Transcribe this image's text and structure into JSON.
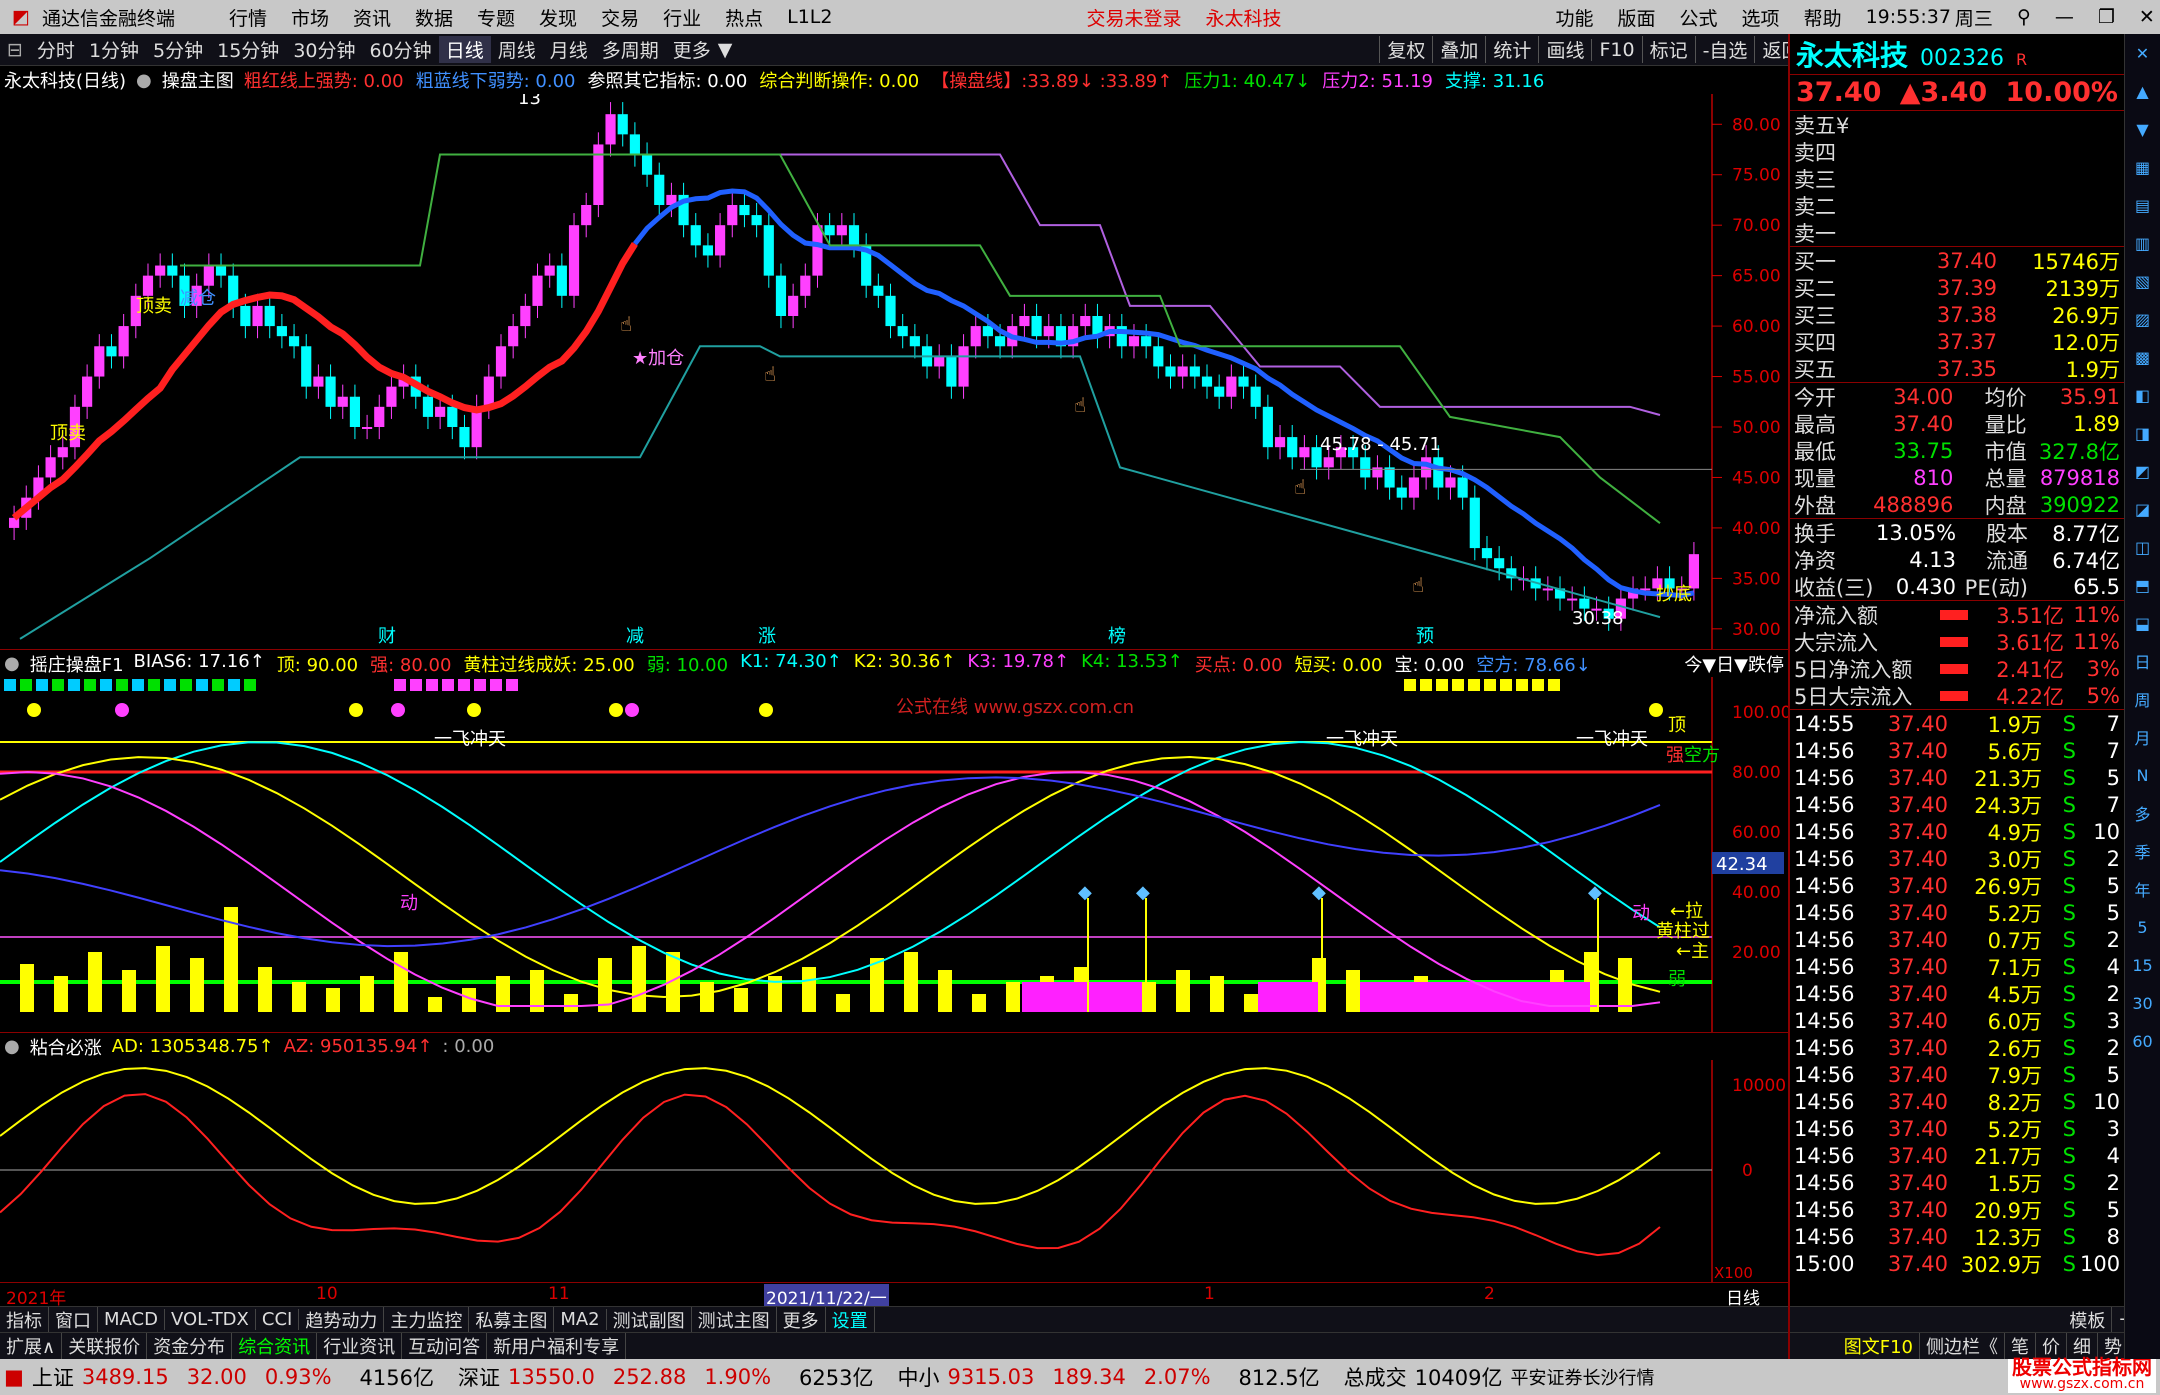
{
  "window": {
    "app": "通达信金融终端",
    "menu": [
      "行情",
      "市场",
      "资讯",
      "数据",
      "专题",
      "发现",
      "交易",
      "行业",
      "热点",
      "L1L2"
    ],
    "status": "交易未登录",
    "stock_center": "永太科技",
    "right_menu": [
      "功能",
      "版面",
      "公式",
      "选项",
      "帮助"
    ],
    "time": "19:55:37",
    "weekday": "周三"
  },
  "toolbar": {
    "periods": [
      "分时",
      "1分钟",
      "5分钟",
      "15分钟",
      "30分钟",
      "60分钟",
      "日线",
      "周线",
      "月线",
      "多周期",
      "更多"
    ],
    "active": "日线",
    "tools": [
      "复权",
      "叠加",
      "统计",
      "画线",
      "F10",
      "标记",
      "-自选",
      "返回"
    ]
  },
  "chart_info": {
    "title": "永太科技(日线)",
    "formula": "操盘主图",
    "items": [
      {
        "t": "粗红线上强势: 0.00",
        "c": "#ff3030"
      },
      {
        "t": "粗蓝线下弱势: 0.00",
        "c": "#4090ff"
      },
      {
        "t": "参照其它指标: 0.00",
        "c": "#ffffff"
      },
      {
        "t": "综合判断操作: 0.00",
        "c": "#ffff00"
      },
      {
        "t": "【操盘线】:33.89↓ :33.89↑",
        "c": "#ff3030"
      },
      {
        "t": "压力1: 40.47↓",
        "c": "#00e000"
      },
      {
        "t": "压力2: 51.19",
        "c": "#ff40ff"
      },
      {
        "t": "支撑: 31.16",
        "c": "#00ffff"
      }
    ]
  },
  "price_axis": [
    "80.00",
    "75.00",
    "70.00",
    "65.00",
    "60.00",
    "55.00",
    "50.00",
    "45.00",
    "40.00",
    "35.00",
    "30.00"
  ],
  "main_labels": {
    "top_sell": "顶卖",
    "reduce": "减仓",
    "add": "★加仓",
    "bottom": "抄底",
    "top": "顶",
    "hi": "13",
    "range": "45.78 - 45.71",
    "low": "30.38",
    "news": [
      "财",
      "减",
      "涨",
      "榜",
      "预"
    ]
  },
  "sub1": {
    "title": "摇庄操盘F1",
    "items": [
      {
        "t": "BIAS6: 17.16↑",
        "c": "#ffffff"
      },
      {
        "t": "顶: 90.00",
        "c": "#ffff00"
      },
      {
        "t": "强: 80.00",
        "c": "#ff3030"
      },
      {
        "t": "黄柱过线成妖: 25.00",
        "c": "#ffff00"
      },
      {
        "t": "弱: 10.00",
        "c": "#00e000"
      },
      {
        "t": "K1: 74.30↑",
        "c": "#00ffff"
      },
      {
        "t": "K2: 30.36↑",
        "c": "#ffff00"
      },
      {
        "t": "K3: 19.78↑",
        "c": "#ff40ff"
      },
      {
        "t": "K4: 13.53↑",
        "c": "#00e000"
      },
      {
        "t": "买点: 0.00",
        "c": "#ff3030"
      },
      {
        "t": "短买: 0.00",
        "c": "#ffff00"
      },
      {
        "t": "宝: 0.00",
        "c": "#ffffff"
      },
      {
        "t": "空方: 78.66↓",
        "c": "#4090ff"
      }
    ],
    "right": "今▼日▼跌停",
    "axis": [
      "100.00",
      "80.00",
      "60.00",
      "40.00",
      "20.00"
    ],
    "cursor": "42.34",
    "watermark": "公式在线 www.gszx.com.cn",
    "labels": {
      "fly": "一飞冲天",
      "top": "顶",
      "strong": "强",
      "kong": "空方",
      "move": "动",
      "pull": "←拉",
      "yellow": "黄柱过",
      "weak": "弱",
      "up": "←主"
    }
  },
  "sub2": {
    "title": "粘合必涨",
    "ad": "AD: 1305348.75↑",
    "az": "AZ: 950135.94↑",
    "z": ": 0.00",
    "axis": [
      "10000",
      "0"
    ],
    "x100": "X100"
  },
  "date_axis": {
    "labels": [
      "2021年",
      "10",
      "11",
      "2021/11/22/一",
      "1",
      "2"
    ],
    "period": "日线"
  },
  "tabs1": [
    "指标",
    "窗口",
    "MACD",
    "VOL-TDX",
    "CCI",
    "趋势动力",
    "主力监控",
    "私募主图",
    "MA2",
    "测试副图",
    "测试主图",
    "更多",
    "设置"
  ],
  "tabs1_right": [
    "模板",
    "+",
    "-"
  ],
  "tabs2": [
    "扩展∧",
    "关联报价",
    "资金分布",
    "综合资讯",
    "行业资讯",
    "互动问答",
    "新用户福利专享"
  ],
  "tabs2_right": [
    "图文F10",
    "侧边栏《",
    "笔",
    "价",
    "细",
    "势",
    "联"
  ],
  "status_bar": {
    "sh": {
      "n": "上证",
      "v": "3489.15",
      "c": "32.00",
      "p": "0.93%",
      "a": "4156亿"
    },
    "sz": {
      "n": "深证",
      "v": "13550.0",
      "c": "252.88",
      "p": "1.90%",
      "a": "6253亿"
    },
    "zx": {
      "n": "中小",
      "v": "9315.03",
      "c": "189.34",
      "p": "2.07%",
      "a": "812.5亿"
    },
    "total": "总成交",
    "tv": "10409亿",
    "broker": "平安证券长沙行情",
    "logo": "股票公式指标网",
    "logo_url": "www.gszx.com.cn"
  },
  "quote": {
    "name": "永太科技",
    "code": "002326",
    "r": "R",
    "price": "37.40",
    "chg": "▲3.40",
    "pct": "10.00%",
    "asks": [
      {
        "l": "卖五",
        "p": "",
        "v": "",
        "m": "¥"
      },
      {
        "l": "卖四",
        "p": "",
        "v": ""
      },
      {
        "l": "卖三",
        "p": "",
        "v": ""
      },
      {
        "l": "卖二",
        "p": "",
        "v": ""
      },
      {
        "l": "卖一",
        "p": "",
        "v": ""
      }
    ],
    "bids": [
      {
        "l": "买一",
        "p": "37.40",
        "v": "15746万"
      },
      {
        "l": "买二",
        "p": "37.39",
        "v": "2139万"
      },
      {
        "l": "买三",
        "p": "37.38",
        "v": "26.9万"
      },
      {
        "l": "买四",
        "p": "37.37",
        "v": "12.0万"
      },
      {
        "l": "买五",
        "p": "37.35",
        "v": "1.9万"
      }
    ],
    "stats": [
      [
        "今开",
        "34.00",
        "均价",
        "35.91"
      ],
      [
        "最高",
        "37.40",
        "量比",
        "1.89"
      ],
      [
        "最低",
        "33.75",
        "市值",
        "327.8亿"
      ],
      [
        "现量",
        "810",
        "总量",
        "879818"
      ],
      [
        "外盘",
        "488896",
        "内盘",
        "390922"
      ]
    ],
    "stats2": [
      [
        "换手",
        "13.05%",
        "股本",
        "8.77亿"
      ],
      [
        "净资",
        "4.13",
        "流通",
        "6.74亿"
      ],
      [
        "收益(三)",
        "0.430",
        "PE(动)",
        "65.5"
      ]
    ],
    "flows": [
      [
        "净流入额",
        "3.51亿",
        "11%"
      ],
      [
        "大宗流入",
        "3.61亿",
        "11%"
      ],
      [
        "5日净流入额",
        "2.41亿",
        "3%"
      ],
      [
        "5日大宗流入",
        "4.22亿",
        "5%"
      ]
    ],
    "ticks": [
      [
        "14:55",
        "37.40",
        "1.9万",
        "S",
        "7"
      ],
      [
        "14:56",
        "37.40",
        "5.6万",
        "S",
        "7"
      ],
      [
        "14:56",
        "37.40",
        "21.3万",
        "S",
        "5"
      ],
      [
        "14:56",
        "37.40",
        "24.3万",
        "S",
        "7"
      ],
      [
        "14:56",
        "37.40",
        "4.9万",
        "S",
        "10"
      ],
      [
        "14:56",
        "37.40",
        "3.0万",
        "S",
        "2"
      ],
      [
        "14:56",
        "37.40",
        "26.9万",
        "S",
        "5"
      ],
      [
        "14:56",
        "37.40",
        "5.2万",
        "S",
        "5"
      ],
      [
        "14:56",
        "37.40",
        "0.7万",
        "S",
        "2"
      ],
      [
        "14:56",
        "37.40",
        "7.1万",
        "S",
        "4"
      ],
      [
        "14:56",
        "37.40",
        "4.5万",
        "S",
        "2"
      ],
      [
        "14:56",
        "37.40",
        "6.0万",
        "S",
        "3"
      ],
      [
        "14:56",
        "37.40",
        "2.6万",
        "S",
        "2"
      ],
      [
        "14:56",
        "37.40",
        "7.9万",
        "S",
        "5"
      ],
      [
        "14:56",
        "37.40",
        "8.2万",
        "S",
        "10"
      ],
      [
        "14:56",
        "37.40",
        "5.2万",
        "S",
        "3"
      ],
      [
        "14:56",
        "37.40",
        "21.7万",
        "S",
        "4"
      ],
      [
        "14:56",
        "37.40",
        "1.5万",
        "S",
        "2"
      ],
      [
        "14:56",
        "37.40",
        "20.9万",
        "S",
        "5"
      ],
      [
        "14:56",
        "37.40",
        "12.3万",
        "S",
        "8"
      ],
      [
        "15:00",
        "37.40",
        "302.9万",
        "S",
        "100"
      ]
    ]
  },
  "side_tools": [
    "日",
    "周",
    "月",
    "N",
    "多",
    "季",
    "年",
    "5",
    "15",
    "30",
    "60"
  ],
  "colors": {
    "up": "#ff40ff",
    "down": "#00ffff",
    "ma_red": "#ff2020",
    "ma_blue": "#2060ff"
  }
}
